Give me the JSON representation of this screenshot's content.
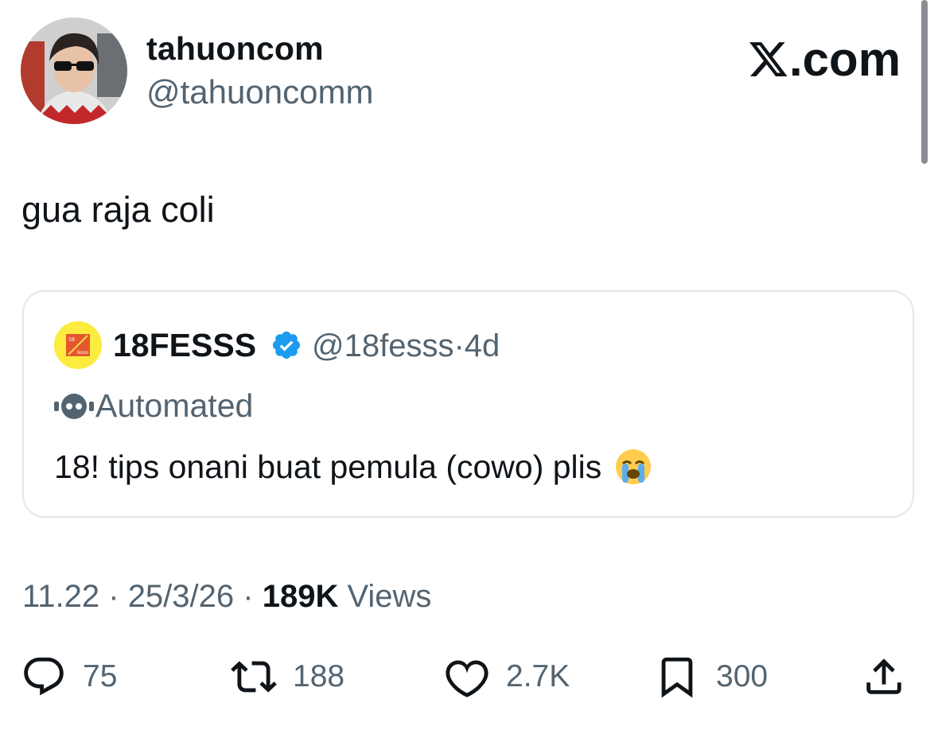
{
  "author": {
    "display_name": "tahuoncom",
    "handle": "@tahuoncomm"
  },
  "brand": {
    "label": ".com",
    "x_glyph": "𝕏"
  },
  "tweet": {
    "text": "gua raja coli"
  },
  "quote": {
    "display_name": "18FESSS",
    "handle": "@18fesss",
    "separator": "·",
    "time": "4d",
    "automated_label": "Automated",
    "text": "18! tips onani buat pemula (cowo) plis",
    "avatar_text_top": "18",
    "avatar_text_bottom": "fesss"
  },
  "meta": {
    "time": "11.22",
    "date": "25/3/26",
    "views_count": "189K",
    "views_label": " Views",
    "dot": " · "
  },
  "actions": {
    "replies": "75",
    "reposts": "188",
    "likes": "2.7K",
    "bookmarks": "300"
  },
  "colors": {
    "text": "#0f1419",
    "secondary": "#536471",
    "border": "#e1e8ed",
    "verified": "#1d9bf0"
  },
  "icons": [
    "reply-icon",
    "repost-icon",
    "like-icon",
    "bookmark-icon",
    "share-icon",
    "verified-badge-icon",
    "automated-bot-icon",
    "x-logo-icon",
    "loudly-crying-face-emoji"
  ]
}
